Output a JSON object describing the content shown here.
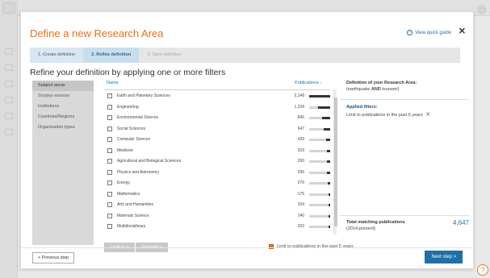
{
  "modal": {
    "title": "Define a new Research Area",
    "quick_guide": "View quick guide",
    "close": "✕"
  },
  "steps": [
    {
      "label": "1. Create definition",
      "state": "done"
    },
    {
      "label": "2. Refine definition",
      "state": "active"
    },
    {
      "label": "3. Save definition",
      "state": "future"
    }
  ],
  "subtitle": "Refine your definition by applying one or more filters",
  "filters": {
    "items": [
      "Subject areas",
      "Scopus sources",
      "Institutions",
      "Countries/Regions",
      "Organization types"
    ],
    "active": "Subject areas"
  },
  "list": {
    "col_name": "Name",
    "col_pubs": "Publications",
    "sort_arrow": "↓",
    "max_value": 2148,
    "rows": [
      {
        "name": "Earth and Planetary Sciences",
        "count": "2,148",
        "value": 2148
      },
      {
        "name": "Engineering",
        "count": "1,234",
        "value": 1234
      },
      {
        "name": "Environmental Science",
        "count": "846",
        "value": 846
      },
      {
        "name": "Social Sciences",
        "count": "647",
        "value": 647
      },
      {
        "name": "Computer Science",
        "count": "439",
        "value": 439
      },
      {
        "name": "Medicine",
        "count": "333",
        "value": 333
      },
      {
        "name": "Agricultural and Biological Sciences",
        "count": "330",
        "value": 330
      },
      {
        "name": "Physics and Astronomy",
        "count": "296",
        "value": 296
      },
      {
        "name": "Energy",
        "count": "276",
        "value": 276
      },
      {
        "name": "Mathematics",
        "count": "175",
        "value": 175
      },
      {
        "name": "Arts and Humanities",
        "count": "154",
        "value": 154
      },
      {
        "name": "Materials Science",
        "count": "140",
        "value": 140
      },
      {
        "name": "Multidisciplinary",
        "count": "102",
        "value": 102
      }
    ]
  },
  "actions": {
    "limit_to": "Limit to",
    "exclude": "Exclude",
    "limit_check": "Limit to publications in the past 5 years"
  },
  "right_panel": {
    "def_title": "Definition of your Research Area:",
    "query_prefix": "(earthquake ",
    "query_op": "AND",
    "query_suffix": " tsunami)",
    "applied_title": "Applied filters:",
    "applied_text": "Limit to publications in the past 5 years",
    "applied_remove": "✕",
    "total_title": "Total matching publications",
    "total_sub": "(2014-present)",
    "total_value": "4,647"
  },
  "footer": {
    "prev": "< Previous step",
    "next": "Next step >"
  },
  "colors": {
    "accent": "#e9711c",
    "primary": "#1f6fa8"
  },
  "background": {
    "help_icon": "?"
  }
}
